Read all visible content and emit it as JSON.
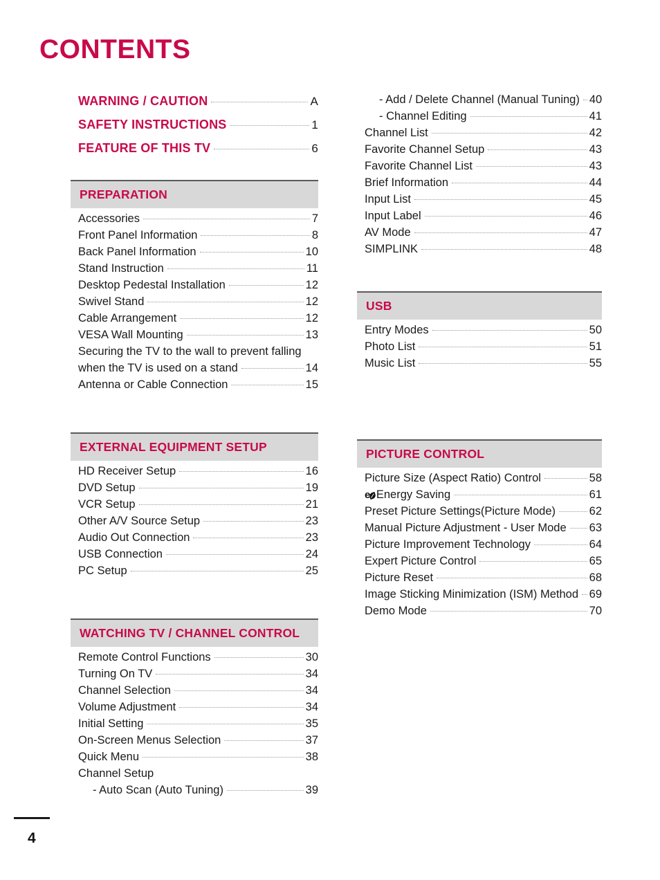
{
  "page": {
    "title": "CONTENTS",
    "number": "4",
    "accent_color": "#c80a4b",
    "section_bar_color": "#d8d8d8"
  },
  "left_column": {
    "top_entries": [
      {
        "title": "WARNING / CAUTION",
        "page": "A"
      },
      {
        "title": "SAFETY INSTRUCTIONS",
        "page": "1"
      },
      {
        "title": "FEATURE OF THIS TV",
        "page": "6"
      }
    ],
    "sections": [
      {
        "heading": "PREPARATION",
        "entries": [
          {
            "title": "Accessories",
            "page": "7"
          },
          {
            "title": "Front Panel Information",
            "page": "8"
          },
          {
            "title": "Back Panel Information",
            "page": "10"
          },
          {
            "title": "Stand Instruction",
            "page": "11"
          },
          {
            "title": "Desktop Pedestal Installation",
            "page": "12"
          },
          {
            "title": "Swivel Stand",
            "page": "12"
          },
          {
            "title": "Cable Arrangement",
            "page": "12"
          },
          {
            "title": "VESA Wall Mounting",
            "page": "13"
          },
          {
            "title": "Securing the TV to the wall to prevent falling",
            "page": ""
          },
          {
            "title": "when the TV is used on a stand",
            "page": "14"
          },
          {
            "title": "Antenna or Cable Connection",
            "page": "15"
          }
        ]
      },
      {
        "heading": "EXTERNAL EQUIPMENT SETUP",
        "entries": [
          {
            "title": "HD Receiver Setup",
            "page": "16"
          },
          {
            "title": "DVD Setup",
            "page": "19"
          },
          {
            "title": "VCR Setup",
            "page": "21"
          },
          {
            "title": "Other A/V Source Setup",
            "page": "23"
          },
          {
            "title": "Audio Out Connection",
            "page": "23"
          },
          {
            "title": "USB Connection",
            "page": "24"
          },
          {
            "title": "PC Setup",
            "page": "25"
          }
        ]
      },
      {
        "heading": "WATCHING TV / CHANNEL CONTROL",
        "entries": [
          {
            "title": "Remote Control Functions",
            "page": "30"
          },
          {
            "title": "Turning On TV",
            "page": "34"
          },
          {
            "title": "Channel Selection",
            "page": "34"
          },
          {
            "title": "Volume Adjustment",
            "page": "34"
          },
          {
            "title": "Initial Setting",
            "page": "35"
          },
          {
            "title": "On-Screen Menus Selection",
            "page": "37"
          },
          {
            "title": "Quick Menu",
            "page": "38"
          },
          {
            "title": "Channel Setup",
            "page": ""
          },
          {
            "title": "- Auto Scan (Auto Tuning)",
            "page": "39",
            "sub": true
          }
        ]
      }
    ]
  },
  "right_column": {
    "continued_entries": [
      {
        "title": "- Add / Delete Channel (Manual Tuning)",
        "page": "40",
        "sub": true
      },
      {
        "title": "- Channel Editing",
        "page": "41",
        "sub": true
      },
      {
        "title": "Channel List",
        "page": "42"
      },
      {
        "title": "Favorite Channel Setup",
        "page": "43"
      },
      {
        "title": "Favorite Channel List",
        "page": "43"
      },
      {
        "title": "Brief Information",
        "page": "44"
      },
      {
        "title": "Input List",
        "page": "45"
      },
      {
        "title": "Input Label",
        "page": "46"
      },
      {
        "title": "AV Mode",
        "page": "47"
      },
      {
        "title": "SIMPLINK",
        "page": "48"
      }
    ],
    "sections": [
      {
        "heading": "USB",
        "entries": [
          {
            "title": "Entry Modes",
            "page": "50"
          },
          {
            "title": "Photo List",
            "page": "51"
          },
          {
            "title": "Music List",
            "page": "55"
          }
        ]
      },
      {
        "heading": "PICTURE CONTROL",
        "entries": [
          {
            "title": "Picture Size (Aspect Ratio) Control",
            "page": "58"
          },
          {
            "title": "Energy Saving",
            "page": "61",
            "icon": "eco-energy-saving-icon"
          },
          {
            "title": "Preset Picture Settings(Picture Mode)",
            "page": "62"
          },
          {
            "title": "Manual Picture Adjustment - User Mode",
            "page": "63"
          },
          {
            "title": "Picture Improvement Technology",
            "page": "64"
          },
          {
            "title": "Expert Picture Control",
            "page": "65"
          },
          {
            "title": "Picture Reset",
            "page": "68"
          },
          {
            "title": "Image Sticking Minimization (ISM) Method",
            "page": "69"
          },
          {
            "title": "Demo Mode",
            "page": "70"
          }
        ]
      }
    ]
  }
}
